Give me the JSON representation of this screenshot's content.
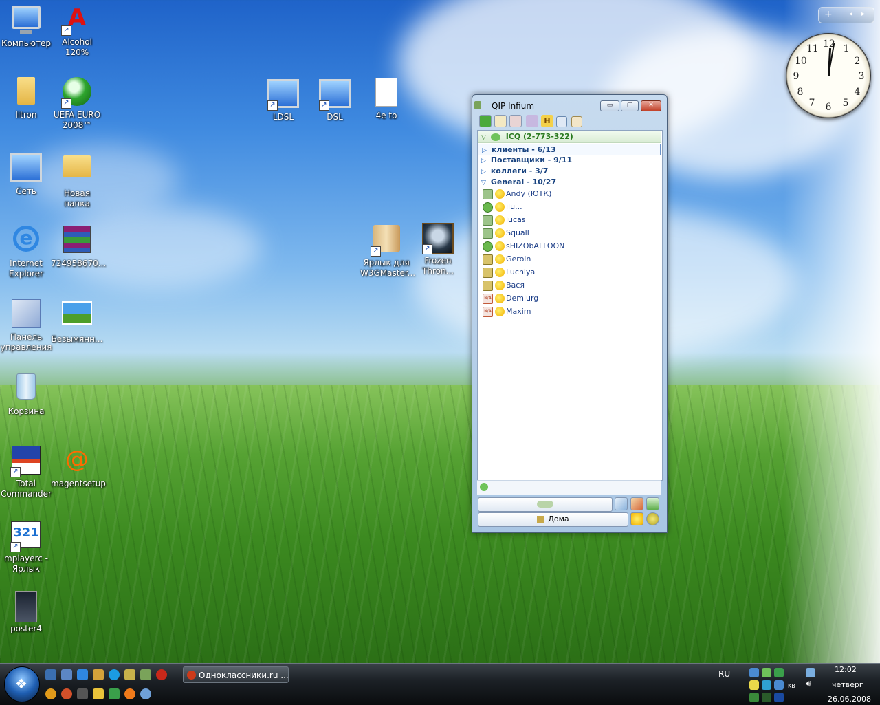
{
  "desktop": {
    "icons": [
      {
        "id": "computer",
        "label": "Компьютер"
      },
      {
        "id": "alcohol",
        "label": "Alcohol 120%"
      },
      {
        "id": "litron",
        "label": "litron"
      },
      {
        "id": "uefa",
        "label": "UEFA EURO 2008™"
      },
      {
        "id": "ldsl",
        "label": "LDSL"
      },
      {
        "id": "dsl",
        "label": "DSL"
      },
      {
        "id": "4eto",
        "label": "4e to"
      },
      {
        "id": "network",
        "label": "Сеть"
      },
      {
        "id": "newfolder",
        "label": "Новая папка"
      },
      {
        "id": "ie",
        "label": "Internet Explorer"
      },
      {
        "id": "rar",
        "label": "724958670..."
      },
      {
        "id": "w3g",
        "label": "Ярлык для W3GMaster..."
      },
      {
        "id": "frozen",
        "label": "Frozen Thron..."
      },
      {
        "id": "controlpanel",
        "label": "Панель управления"
      },
      {
        "id": "untitled",
        "label": "Безымянн..."
      },
      {
        "id": "recycle",
        "label": "Корзина"
      },
      {
        "id": "totalcmd",
        "label": "Total Commander"
      },
      {
        "id": "magent",
        "label": "magentsetup"
      },
      {
        "id": "mplayer",
        "label": "mplayerc - Ярлык"
      },
      {
        "id": "poster",
        "label": "poster4"
      }
    ]
  },
  "gadgets": {
    "bar": {
      "add": "+",
      "prev": "◂",
      "next": "▸"
    },
    "clock": {
      "numbers": [
        "12",
        "1",
        "2",
        "3",
        "4",
        "5",
        "6",
        "7",
        "8",
        "9",
        "10",
        "11"
      ]
    }
  },
  "qip": {
    "title": "QIP Infium",
    "window_buttons": {
      "minimize": "▭",
      "maximize": "▢",
      "close": "✕"
    },
    "account": "ICQ (2-773-322)",
    "groups": [
      {
        "label": "клиенты - 6/13",
        "expanded": false
      },
      {
        "label": "Поставщики - 9/11",
        "expanded": false
      },
      {
        "label": "коллеги - 3/7",
        "expanded": false
      },
      {
        "label": "General - 10/27",
        "expanded": true
      }
    ],
    "contacts": [
      {
        "name": "Andy (ЮТК)",
        "status": "online"
      },
      {
        "name": "ilu...",
        "status": "ffc"
      },
      {
        "name": "lucas",
        "status": "online"
      },
      {
        "name": "Squall",
        "status": "online"
      },
      {
        "name": "sHIZObALLOON",
        "status": "ffc"
      },
      {
        "name": "Geroin",
        "status": "away"
      },
      {
        "name": "Luchiya",
        "status": "away"
      },
      {
        "name": "Вася",
        "status": "away"
      },
      {
        "name": "Demiurg",
        "status": "na"
      },
      {
        "name": "Maxim",
        "status": "na"
      }
    ],
    "na_badge": "N/A",
    "status_button": "Дома"
  },
  "taskbar": {
    "start_glyph": "❖",
    "task_button": "Одноклассники.ru ...",
    "language": "RU",
    "time": "12:02",
    "day": "четверг",
    "date": "26.06.2008",
    "kb_label": "KB"
  },
  "colors": {
    "qip_frame": "#a9c6e4",
    "contact_text": "#1b3d87",
    "group_text": "#1a4480",
    "account_text": "#2a7a1f"
  }
}
